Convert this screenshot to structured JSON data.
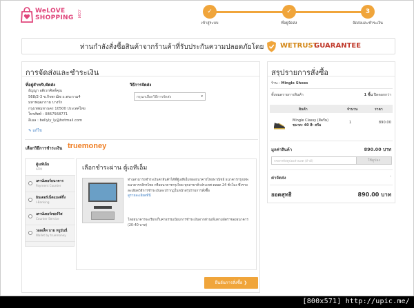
{
  "logo": {
    "line1": "WeLOVE",
    "line2": "SHOPPING",
    "suffix": ".COM"
  },
  "steps": [
    {
      "number": "✓",
      "label": "เข้าสู่ระบบ"
    },
    {
      "number": "✓",
      "label": "ที่อยู่จัดส่ง"
    },
    {
      "number": "3",
      "label": "จัดส่งและชำระเงิน"
    }
  ],
  "banner": {
    "text": "ท่านกำลังสั่งซื้อสินค้าจากร้านค้าที่รับประกันความปลอดภัยโดย",
    "wetrust": "WETRUST",
    "guarantee": "GUARANTEE"
  },
  "left": {
    "title": "การจัดส่งและชำระเงิน",
    "address_title": "ที่อยู่สำหรับจัดส่ง",
    "address_lines": [
      "ธัญญา อติเรกศิลพ์คุณ",
      "568/2-3 ซ.กิจพาณิช ถ.พระราม4",
      "มหาพฤฒาราม บางรัก",
      "กรุงเทพมหานคร 10500 ประเทศไทย",
      "โทรศัพท์ : 0867568771",
      "อีเมล : bellyly_ly@hotmail.com"
    ],
    "edit_label": "✎ แก้ไข",
    "shipping_title": "วิธีการจัดส่ง",
    "shipping_select": "กรุณาเลือกวิธีการจัดส่ง",
    "payment_label": "เลือกวิธีการชำระเงิน",
    "truemoney": "truemoney",
    "methods": [
      {
        "name": "ตู้เอทีเอ็ม",
        "sub": "ATM"
      },
      {
        "name": "เคาน์เตอร์ธนาคาร",
        "sub": "Payment Counter"
      },
      {
        "name": "อินเตอร์เน็ตแบงค์กิ้ง",
        "sub": "I-Banking"
      },
      {
        "name": "เคาน์เตอร์เซอร์วิส",
        "sub": "Counter Service"
      },
      {
        "name": "วอลเล็ท บาย ทรูมันนี่",
        "sub": "Wallet by truemoney"
      }
    ],
    "atm": {
      "title": "เลือกชำระผ่าน ตู้เอทีเอ็ม",
      "description": "ท่านสามารถชำระเงินค่าสินค้าได้ที่ตู้เอทีเอ็มของธนาคารไทยพาณิชย์ ธนาคารกรุงเทพ ธนาคารกสิกรไทย หรือธนาคารกรุงไทย ทุกสาขาทั่วประเทศ ตลอด 24 ชั่วโมง ซึ่งรายละเอียดวิธีการชำระเงินจะปรากฏในหน้าสรุปรายการสั่งซื้อ",
      "link": "ดูรายละเอียดที่นี่",
      "note": "โดยธนาคารจะเรียกเก็บค่าธรรมเนียมการชำระเงินจากท่านเพิ่มตามอัตราของธนาคาร (20-40 บาท)"
    },
    "confirm_button": "ยืนยันการสั่งซื้อ ❯"
  },
  "right": {
    "title": "สรุปรายการสั่งซื้อ",
    "shop_label": "ร้าน :",
    "shop_name": "Mingle Shoes",
    "count_label": "ทั้งหมดรายการสินค้า",
    "count_value": "1 ชิ้น",
    "count_link": "ปิดดอกกว่า",
    "headers": {
      "product": "สินค้า",
      "qty": "จำนวน",
      "price": "ราคา"
    },
    "item": {
      "name": "Mingle Classy (สีครีม)",
      "size": "ขนาด: 40 สี: ครีม",
      "qty": "1",
      "price": "890.00"
    },
    "subtotal_label": "มูลค่าสินค้า",
    "subtotal_value": "890.00 บาท",
    "coupon_placeholder": "กรอกรหัสคูปองส่วนลด (ถ้ามี)",
    "coupon_button": "ใช้คูปอง",
    "shipping_label": "ค่าจัดส่ง",
    "shipping_value": "-",
    "net_label": "ยอดสุทธิ",
    "net_value": "890.00 บาท"
  },
  "footer": {
    "text": "[800x571] http://upic.me/"
  },
  "colors": {
    "accent": "#f0a53b",
    "brand": "#e0457b",
    "truemoney": "#ef7d22",
    "guarantee": "#c0392b"
  }
}
